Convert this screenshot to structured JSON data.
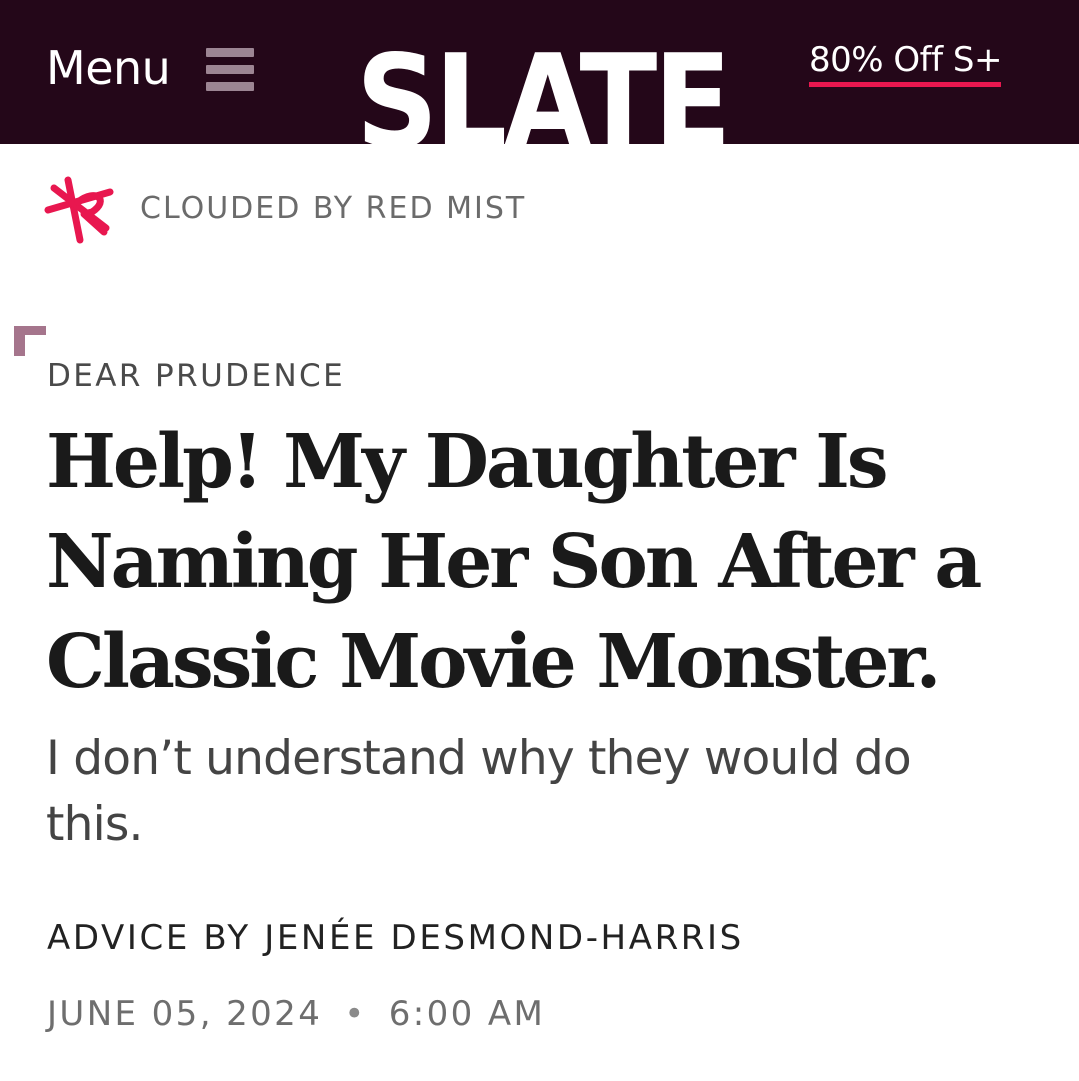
{
  "header": {
    "menu_label": "Menu",
    "logo_text": "SLATE",
    "promo_label": "80% Off S+",
    "colors": {
      "background": "#240719",
      "promo_underline": "#e8174f",
      "hamburger": "#9c8593"
    },
    "icons": {
      "menu": "hamburger-icon",
      "logo": "slate-logo"
    }
  },
  "column": {
    "label": "CLOUDED BY RED MIST",
    "icon": "red-mist-star-icon",
    "icon_color": "#e8174f"
  },
  "article": {
    "kicker": "DEAR PRUDENCE",
    "headline": "Help! My Daughter Is Naming Her Son After a Classic Movie Monster.",
    "dek": "I don’t understand why they would do this.",
    "byline_prefix": "ADVICE BY",
    "author": "JENÉE DESMOND-HARRIS",
    "date": "JUNE 05, 2024",
    "separator": "•",
    "time": "6:00 AM",
    "accent_color": "#a5758c"
  }
}
